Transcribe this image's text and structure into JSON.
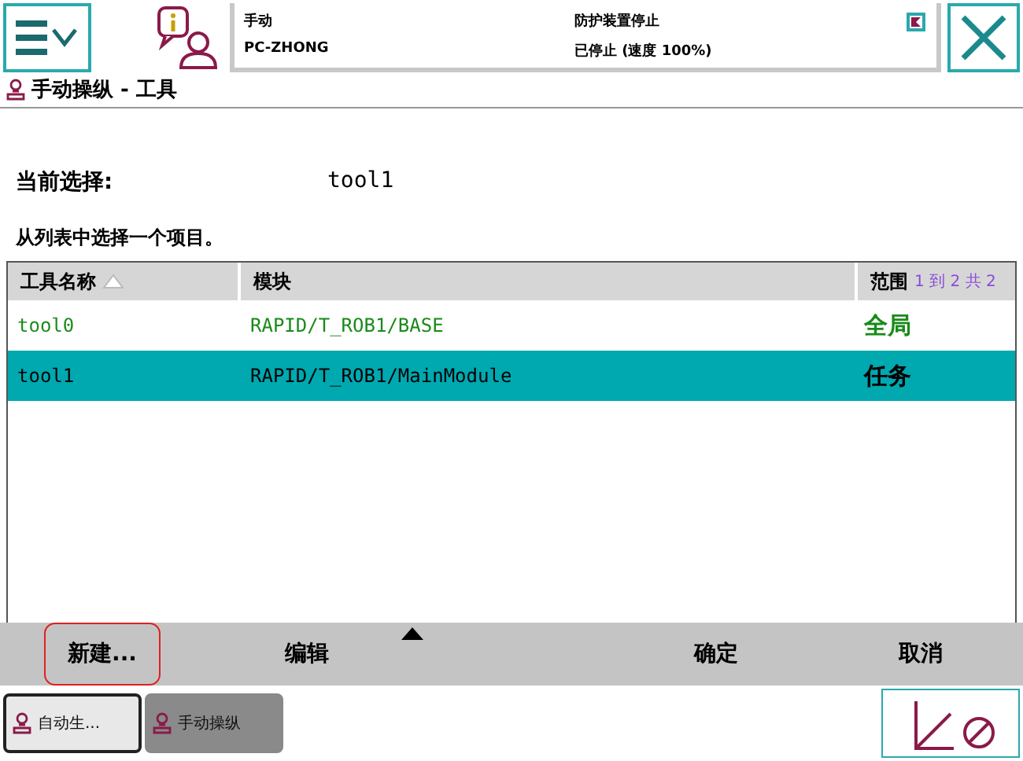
{
  "status": {
    "mode": "手动",
    "controller": "PC-ZHONG",
    "safety": "防护装置停止",
    "state": "已停止 (速度 100%)"
  },
  "title": "手动操纵 - 工具",
  "current": {
    "label": "当前选择:",
    "value": "tool1"
  },
  "instruction": "从列表中选择一个项目。",
  "table": {
    "columns": [
      "工具名称",
      "模块",
      "范围"
    ],
    "range": "1 到 2 共 2",
    "rows": [
      {
        "cells": [
          "tool0",
          "RAPID/T_ROB1/BASE",
          "全局"
        ],
        "selected": false
      },
      {
        "cells": [
          "tool1",
          "RAPID/T_ROB1/MainModule",
          "任务"
        ],
        "selected": true
      }
    ]
  },
  "commands": [
    {
      "label": "新建...",
      "highlighted": true
    },
    {
      "label": "编辑",
      "highlighted": false,
      "menu": true
    },
    {
      "label": "确定",
      "highlighted": false
    },
    {
      "label": "取消",
      "highlighted": false
    }
  ],
  "taskbar": [
    {
      "label": "自动生...",
      "selected": true
    },
    {
      "label": "手动操纵",
      "selected": false
    }
  ]
}
